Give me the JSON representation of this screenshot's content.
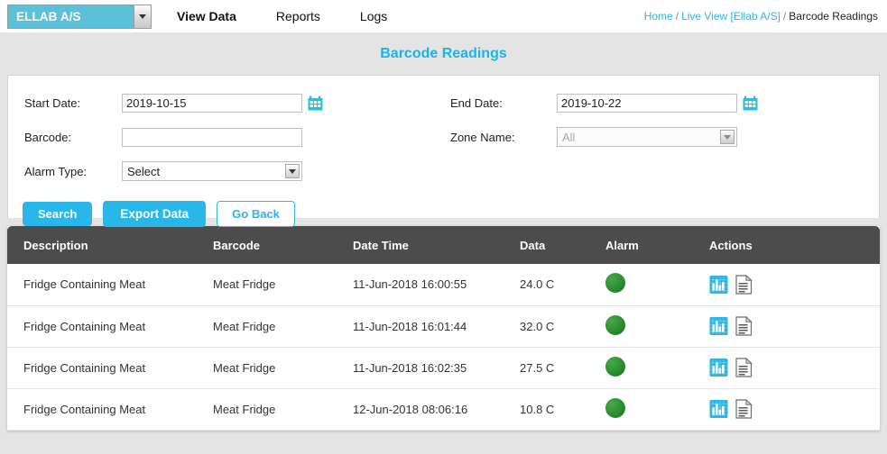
{
  "topbar": {
    "company_selector": {
      "value": "ELLAB A/S",
      "icon": "chevron-down-icon"
    },
    "nav": [
      {
        "label": "View Data",
        "active": true
      },
      {
        "label": "Reports",
        "active": false
      },
      {
        "label": "Logs",
        "active": false
      }
    ],
    "breadcrumb": {
      "home": "Home",
      "sep1": "/",
      "live_view": "Live View [Ellab A/S]",
      "sep2": "/",
      "current": "Barcode Readings"
    }
  },
  "page": {
    "title": "Barcode Readings",
    "title_color": "#19b5ea"
  },
  "filters": {
    "start_date": {
      "label": "Start Date:",
      "value": "2019-10-15",
      "calendar_icon": "calendar-icon"
    },
    "end_date": {
      "label": "End Date:",
      "value": "2019-10-22",
      "calendar_icon": "calendar-icon"
    },
    "barcode": {
      "label": "Barcode:",
      "value": "",
      "placeholder": ""
    },
    "zone_name": {
      "label": "Zone Name:",
      "value": "All",
      "disabled": true
    },
    "alarm_type": {
      "label": "Alarm Type:",
      "value": "Select"
    }
  },
  "actions": {
    "search": "Search",
    "export": "Export Data",
    "go_back": "Go Back"
  },
  "table": {
    "columns": [
      "Description",
      "Barcode",
      "Date Time",
      "Data",
      "Alarm",
      "Actions"
    ],
    "rows": [
      {
        "description": "Fridge Containing Meat",
        "barcode": "Meat Fridge",
        "date_time": "11-Jun-2018 16:00:55",
        "data": "24.0 C",
        "alarm_status": "ok",
        "alarm_color": "#2f9234",
        "action_icons": [
          "chart-icon",
          "report-icon"
        ]
      },
      {
        "description": "Fridge Containing Meat",
        "barcode": "Meat Fridge",
        "date_time": "11-Jun-2018 16:01:44",
        "data": "32.0 C",
        "alarm_status": "ok",
        "alarm_color": "#2f9234",
        "action_icons": [
          "chart-icon",
          "report-icon"
        ]
      },
      {
        "description": "Fridge Containing Meat",
        "barcode": "Meat Fridge",
        "date_time": "11-Jun-2018 16:02:35",
        "data": "27.5 C",
        "alarm_status": "ok",
        "alarm_color": "#2f9234",
        "action_icons": [
          "chart-icon",
          "report-icon"
        ]
      },
      {
        "description": "Fridge Containing Meat",
        "barcode": "Meat Fridge",
        "date_time": "12-Jun-2018 08:06:16",
        "data": "10.8 C",
        "alarm_status": "ok",
        "alarm_color": "#2f9234",
        "action_icons": [
          "chart-icon",
          "report-icon"
        ]
      }
    ]
  },
  "theme": {
    "accent": "#29b6e8",
    "company_bg": "#5bc0d8",
    "header_bg": "#4c4c4c",
    "page_bg": "#e4e4e4"
  }
}
